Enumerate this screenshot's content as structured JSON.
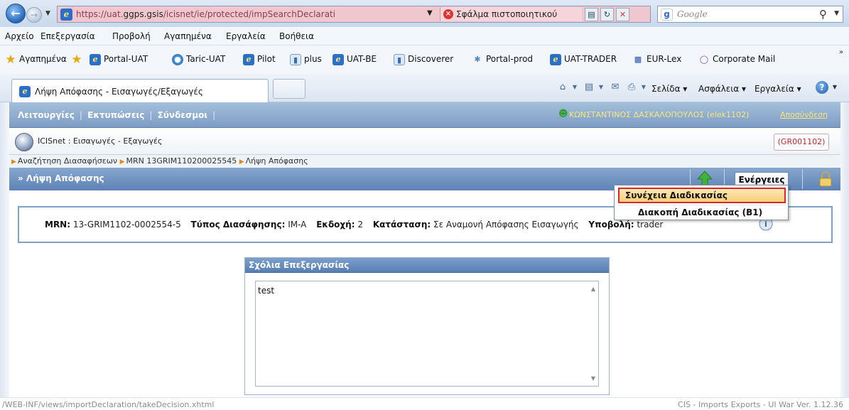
{
  "browser": {
    "url_prefix": "https://uat.",
    "url_host": "ggps.gsis",
    "url_path": "/icisnet/ie/protected/impSearchDeclarati",
    "cert_error": "Σφάλμα πιστοποιητικού",
    "search_placeholder": "Google"
  },
  "menu": {
    "items": [
      "Αρχείο",
      "Επεξεργασία",
      "Προβολή",
      "Αγαπημένα",
      "Εργαλεία",
      "Βοήθεια"
    ]
  },
  "favorites": {
    "label": "Αγαπημένα",
    "items": [
      "Portal-UAT",
      "Taric-UAT",
      "Pilot",
      "plus",
      "UAT-BE",
      "Discoverer",
      "Portal-prod",
      "UAT-TRADER",
      "EUR-Lex",
      "Corporate Mail"
    ]
  },
  "tab": {
    "title": "Λήψη Απόφασης - Εισαγωγές/Εξαγωγές"
  },
  "commandbar": {
    "page": "Σελίδα",
    "safety": "Ασφάλεια",
    "tools": "Εργαλεία"
  },
  "app": {
    "menu": [
      "Λειτουργίες",
      "Εκτυπώσεις",
      "Σύνδεσμοι"
    ],
    "user": "ΚΩΝΣΤΑΝΤΙΝΟΣ ΔΑΣΚΑΛΟΠΟΥΛΟΣ (elek1102)",
    "logout": "Αποσύνδεση",
    "name": "ICISnet : Εισαγωγές - Εξαγωγές",
    "code": "(GR001102)",
    "breadcrumb": [
      "Αναζήτηση Διασαφήσεων",
      "MRN 13GRIM110200025545",
      "Λήψη Απόφασης"
    ],
    "section_title": "» Λήψη Απόφασης",
    "actions_label": "Ενέργειες"
  },
  "info": {
    "mrn_label": "MRN:",
    "mrn_value": "13-GRIM1102-0002554-5",
    "type_label": "Τύπος Διασάφησης:",
    "type_value": "IM-A",
    "version_label": "Εκδοχή:",
    "version_value": "2",
    "status_label": "Κατάσταση:",
    "status_value": "Σε Αναμονή Απόφασης Εισαγωγής",
    "submission_label": "Υποβολή:",
    "submission_value": "trader"
  },
  "comments": {
    "title": "Σχόλια Επεξεργασίας",
    "value": "test"
  },
  "dropdown": {
    "items": [
      "Συνέχεια Διαδικασίας",
      "Διακοπή Διαδικασίας (B1)"
    ]
  },
  "status": {
    "path": "/WEB-INF/views/importDeclaration/takeDecision.xhtml",
    "version": "CIS - Imports Exports - UI War Ver. 1.12.36"
  }
}
